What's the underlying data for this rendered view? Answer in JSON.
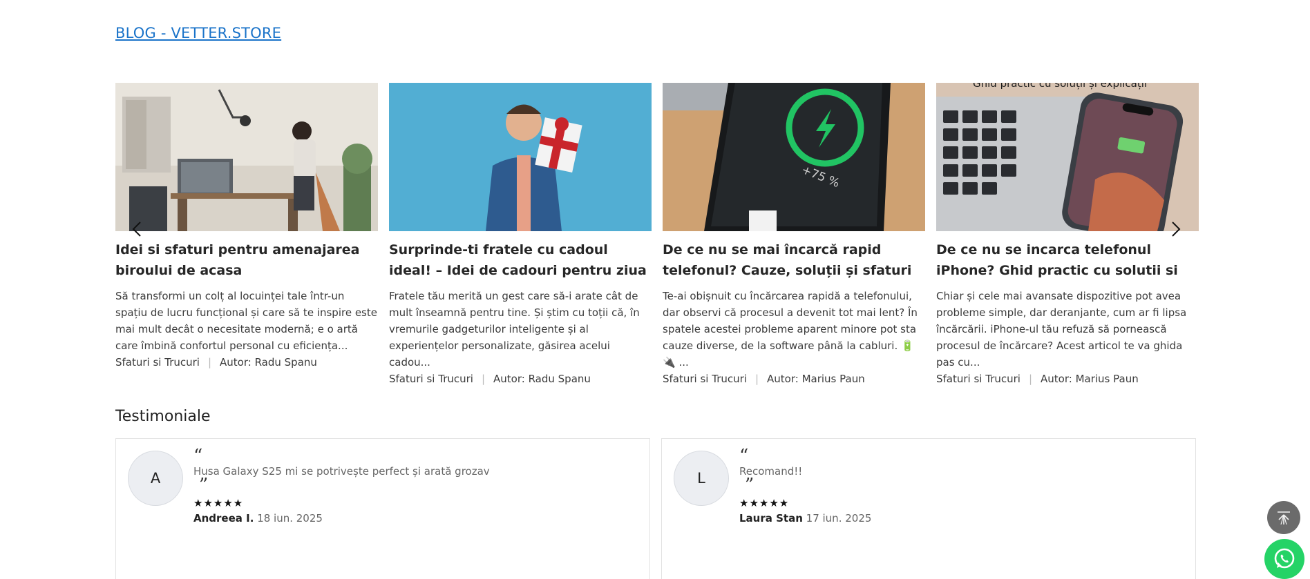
{
  "blog": {
    "link_label": "BLOG - VETTER.STORE"
  },
  "posts": [
    {
      "title": "Idei si sfaturi pentru amenajarea biroului de acasa",
      "excerpt": "Să transformi un colț al locuinței tale într-un spațiu de lucru funcțional și care să te inspire este mai mult decât o necesitate modernă; e o artă care îmbină confortul personal cu eficiența...",
      "category": "Sfaturi si Trucuri",
      "author": "Autor: Radu Spanu"
    },
    {
      "title": "Surprinde-ti fratele cu cadoul ideal! – Idei de cadouri pentru ziua lui de...",
      "excerpt": "Fratele tău merită un gest care să-i arate cât de mult înseamnă pentru tine. Și știm cu toții că, în vremurile gadgeturilor inteligente și al experiențelor personalizate, găsirea acelui cadou...",
      "category": "Sfaturi si Trucuri",
      "author": "Autor: Radu Spanu"
    },
    {
      "title": "De ce nu se mai încarcă rapid telefonul? Cauze, soluții și sfaturi utile",
      "excerpt": "Te-ai obișnuit cu încărcarea rapidă a telefonului, dar observi că procesul a devenit tot mai lent? În spatele acestei probleme aparent minore pot sta cauze diverse, de la software până la cabluri. 🔋 🔌 ...",
      "category": "Sfaturi si Trucuri",
      "author": "Autor: Marius Paun"
    },
    {
      "title": "De ce nu se incarca telefonul iPhone? Ghid practic cu solutii si explicatii",
      "excerpt": "Chiar și cele mai avansate dispozitive pot avea probleme simple, dar deranjante, cum ar fi lipsa încărcării. iPhone-ul tău refuză să pornească procesul de încărcare? Acest articol te va ghida pas cu...",
      "category": "Sfaturi si Trucuri",
      "author": "Autor: Marius Paun",
      "image_caption": "Ghid practic cu soluții și explicații"
    }
  ],
  "phone_charge_label": "+75 %",
  "testimonials_section": {
    "title": "Testimoniale"
  },
  "testimonials": [
    {
      "initial": "A",
      "quote_open": "“",
      "text": "Husa Galaxy S25 mi se potrivește perfect și arată grozav",
      "quote_close": "”",
      "stars": "★★★★★",
      "rating": 5,
      "name": "Andreea I.",
      "date": "18 iun. 2025"
    },
    {
      "initial": "L",
      "quote_open": "“",
      "text": "Recomand!!",
      "quote_close": "”",
      "stars": "★★★★★",
      "rating": 5,
      "name": "Laura Stan",
      "date": "17 iun. 2025"
    }
  ],
  "icons": {
    "prev": "chevron-left-icon",
    "next": "chevron-right-icon",
    "scroll_top": "scroll-to-top-icon",
    "whatsapp": "whatsapp-icon"
  },
  "colors": {
    "link": "#1a73c9",
    "whatsapp": "#25d366",
    "scroll_top": "#6b6b6b"
  }
}
